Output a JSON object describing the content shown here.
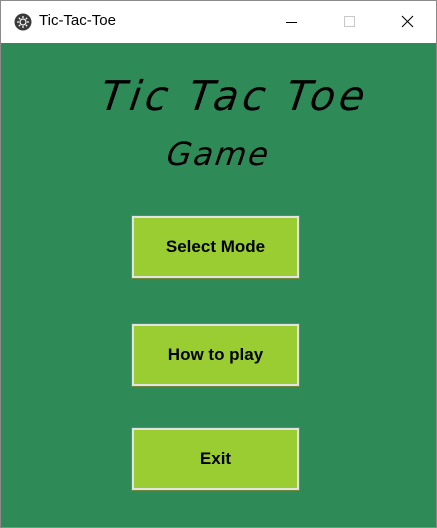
{
  "window": {
    "title": "Tic-Tac-Toe",
    "app_icon": "gear-icon",
    "controls": {
      "minimize_icon": "minimize-icon",
      "maximize_icon": "maximize-icon",
      "close_icon": "close-icon"
    }
  },
  "main": {
    "background_color": "#2e8b57",
    "heading_line1": "Tic Tac Toe",
    "heading_line2": "Game",
    "buttons": [
      {
        "label": "Select Mode"
      },
      {
        "label": "How to play"
      },
      {
        "label": "Exit"
      }
    ],
    "button_color": "#9acd32"
  }
}
